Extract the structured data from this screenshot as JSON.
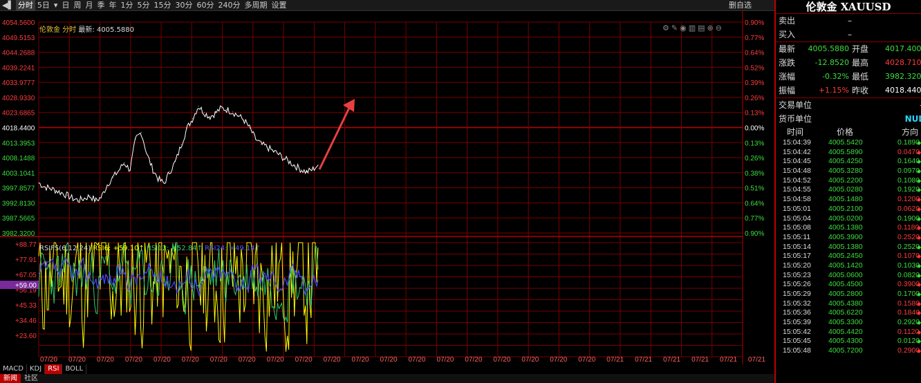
{
  "toolbar": {
    "items": [
      {
        "label": "分时",
        "active": true
      },
      {
        "label": "5日"
      },
      {
        "label": "日"
      },
      {
        "label": "周"
      },
      {
        "label": "月"
      },
      {
        "label": "季"
      },
      {
        "label": "年"
      },
      {
        "label": "1分"
      },
      {
        "label": "5分"
      },
      {
        "label": "15分"
      },
      {
        "label": "30分"
      },
      {
        "label": "60分"
      },
      {
        "label": "240分"
      },
      {
        "label": "多周期"
      },
      {
        "label": "设置"
      }
    ],
    "delete_watch": "删自选"
  },
  "chart": {
    "title_name": "伦敦金",
    "title_mode": "分时",
    "title_latest_label": "最新:",
    "title_latest_value": "4005.5880",
    "price_labels": [
      "4054.5600",
      "4049.5153",
      "4044.2688",
      "4039.2241",
      "4033.9777",
      "4028.9330",
      "4023.6865",
      "4018.4400",
      "4013.3953",
      "4008.1488",
      "4003.1041",
      "3997.8577",
      "3992.8130",
      "3987.5665",
      "3982.3200"
    ],
    "pct_labels": [
      "0.90%",
      "0.77%",
      "0.64%",
      "0.52%",
      "0.39%",
      "0.26%",
      "0.13%",
      "0.00%",
      "0.13%",
      "0.26%",
      "0.38%",
      "0.51%",
      "0.64%",
      "0.77%",
      "0.90%"
    ],
    "rsi_labels": [
      "+88.77",
      "+77.91",
      "+67.05",
      "+56.19",
      "+45.33",
      "+34.46",
      "+23.60"
    ],
    "rsi_current": "+59.00",
    "rsi_legend": {
      "name": "RSIFS(6,12,24)",
      "rsi6": "RSI6: +59.10↑",
      "rsi12": "RSI12: +52.84↑",
      "rsi24": "RSI24: +49.14↑"
    },
    "x_labels": [
      "07/20",
      "07/20",
      "07/20",
      "07/20",
      "07/20",
      "07/20",
      "07/20",
      "07/20",
      "07/20",
      "07/20",
      "07/20",
      "07/20",
      "07/20",
      "07/20",
      "07/20",
      "07/20",
      "07/20",
      "07/20",
      "07/20",
      "07/20",
      "07/21",
      "07/21",
      "07/21",
      "07/21",
      "07/21",
      "07/21"
    ],
    "colors": {
      "up": "#ff3b3b",
      "down": "#3cde3c",
      "grid": "#7a0000",
      "rsi6": "#ffff00",
      "rsi12": "#2ecc71",
      "rsi24": "#4a4aff",
      "annotation_arrow": "#e84040"
    }
  },
  "chart_data": {
    "type": "line",
    "title": "伦敦金 分时",
    "ylim": [
      3982.32,
      4054.56
    ],
    "reference_price": 4018.44,
    "series": [
      {
        "values": [
          3999.5,
          3998.2,
          3997.6,
          3996.9,
          3996.1,
          3995.2,
          3994.1,
          3993.5,
          3994.2,
          3995.0,
          3993.4,
          3994.6,
          3998.8,
          4001.3,
          4003.6,
          4006.4,
          4003.9,
          4014.5,
          4016.8,
          4009.2,
          4004.1,
          4000.8,
          3999.2,
          4003.4,
          4006.8,
          4012.5,
          4018.2,
          4021.5,
          4025.8,
          4023.6,
          4022.1,
          4023.4,
          4025.1,
          4024.6,
          4023.8,
          4022.5,
          4021.0,
          4018.3,
          4014.6,
          4012.7,
          4011.8,
          4010.5,
          4009.4,
          4007.9,
          4006.7,
          4005.3,
          4004.1,
          4003.2,
          4004.0,
          4005.59
        ]
      }
    ]
  },
  "indicator_tabs": [
    {
      "label": "MACD"
    },
    {
      "label": "KDJ"
    },
    {
      "label": "RSI",
      "active": true
    },
    {
      "label": "BOLL"
    }
  ],
  "bottom_tabs": [
    {
      "label": "新闻",
      "active": true
    },
    {
      "label": "社区"
    }
  ],
  "panel": {
    "title": "伦敦金 XAUUSD",
    "sell_label": "卖出",
    "sell_value": "–",
    "buy_label": "买入",
    "buy_value": "–",
    "rows": [
      {
        "k": "最新",
        "v": "4005.5880",
        "vc": "#3cde3c",
        "k2": "开盘",
        "v2": "4017.4000",
        "v2c": "#3cde3c"
      },
      {
        "k": "涨跌",
        "v": "-12.8520",
        "vc": "#3cde3c",
        "k2": "最高",
        "v2": "4028.7100",
        "v2c": "#ff3b3b"
      },
      {
        "k": "涨幅",
        "v": "-0.32%",
        "vc": "#3cde3c",
        "k2": "最低",
        "v2": "3982.3200",
        "v2c": "#3cde3c"
      },
      {
        "k": "振幅",
        "v": "+1.15%",
        "vc": "#ff3b3b",
        "k2": "昨收",
        "v2": "4018.4400",
        "v2c": "#ffffff"
      }
    ],
    "trade_unit_label": "交易单位",
    "trade_unit_value": "–",
    "currency_label": "货币单位",
    "currency_value": "NUL",
    "trades_header": {
      "time": "时间",
      "price": "价格",
      "dir": "方向"
    },
    "trades": [
      {
        "t": "15:04:39",
        "p": "4005.5420",
        "q": "0.1890",
        "up": false
      },
      {
        "t": "15:04:42",
        "p": "4005.5890",
        "q": "0.0470",
        "up": true
      },
      {
        "t": "15:04:45",
        "p": "4005.4250",
        "q": "0.1640",
        "up": false
      },
      {
        "t": "15:04:48",
        "p": "4005.3280",
        "q": "0.0970",
        "up": false
      },
      {
        "t": "15:04:52",
        "p": "4005.2200",
        "q": "0.1080",
        "up": false
      },
      {
        "t": "15:04:55",
        "p": "4005.0280",
        "q": "0.1920",
        "up": false
      },
      {
        "t": "15:04:58",
        "p": "4005.1480",
        "q": "0.1200",
        "up": true
      },
      {
        "t": "15:05:01",
        "p": "4005.2100",
        "q": "0.0620",
        "up": true
      },
      {
        "t": "15:05:04",
        "p": "4005.0200",
        "q": "0.1900",
        "up": false
      },
      {
        "t": "15:05:08",
        "p": "4005.1380",
        "q": "0.1180",
        "up": true
      },
      {
        "t": "15:05:11",
        "p": "4005.3900",
        "q": "0.2520",
        "up": true
      },
      {
        "t": "15:05:14",
        "p": "4005.1380",
        "q": "0.2520",
        "up": false
      },
      {
        "t": "15:05:17",
        "p": "4005.2450",
        "q": "0.1070",
        "up": true
      },
      {
        "t": "15:05:20",
        "p": "4005.1420",
        "q": "0.1030",
        "up": false
      },
      {
        "t": "15:05:23",
        "p": "4005.0600",
        "q": "0.0820",
        "up": false
      },
      {
        "t": "15:05:26",
        "p": "4005.4500",
        "q": "0.3900",
        "up": true
      },
      {
        "t": "15:05:29",
        "p": "4005.2800",
        "q": "0.1700",
        "up": false
      },
      {
        "t": "15:05:32",
        "p": "4005.4380",
        "q": "0.1580",
        "up": true
      },
      {
        "t": "15:05:36",
        "p": "4005.6220",
        "q": "0.1840",
        "up": true
      },
      {
        "t": "15:05:39",
        "p": "4005.3300",
        "q": "0.2920",
        "up": false
      },
      {
        "t": "15:05:42",
        "p": "4005.4420",
        "q": "0.1120",
        "up": true
      },
      {
        "t": "15:05:45",
        "p": "4005.4300",
        "q": "0.0120",
        "up": false
      },
      {
        "t": "15:05:48",
        "p": "4005.7200",
        "q": "0.2900",
        "up": true
      }
    ]
  }
}
